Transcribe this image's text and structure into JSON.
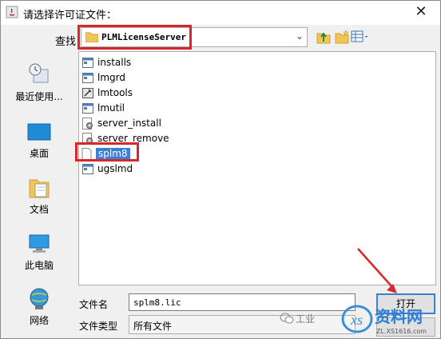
{
  "window": {
    "title": "请选择许可证文件：",
    "close_glyph": "✕"
  },
  "lookin": {
    "label": "查找",
    "value": "PLMLicenseServer"
  },
  "places": [
    {
      "label": "最近使用..."
    },
    {
      "label": "桌面"
    },
    {
      "label": "文档"
    },
    {
      "label": "此电脑"
    },
    {
      "label": "网络"
    }
  ],
  "files": [
    {
      "name": "installs",
      "icon": "exe-window-icon"
    },
    {
      "name": "lmgrd",
      "icon": "exe-window-icon"
    },
    {
      "name": "lmtools",
      "icon": "tool-app-icon"
    },
    {
      "name": "lmutil",
      "icon": "exe-window-icon"
    },
    {
      "name": "server_install",
      "icon": "gear-script-icon"
    },
    {
      "name": "server_remove",
      "icon": "gear-script-icon"
    },
    {
      "name": "splm8",
      "icon": "blank-file-icon",
      "selected": true
    },
    {
      "name": "ugslmd",
      "icon": "exe-window-icon"
    }
  ],
  "form": {
    "filename_label": "文件名",
    "filename_value": "splm8.lic",
    "filetype_label": "文件类型",
    "filetype_value": "所有文件"
  },
  "buttons": {
    "open": "打开"
  },
  "watermark": {
    "text": "工业",
    "logo_text": "资料网",
    "logo_url": "ZL.XS1616.com"
  },
  "colors": {
    "highlight": "#d9262c",
    "selection": "#3b7fd6",
    "arrow": "#d9262c"
  }
}
